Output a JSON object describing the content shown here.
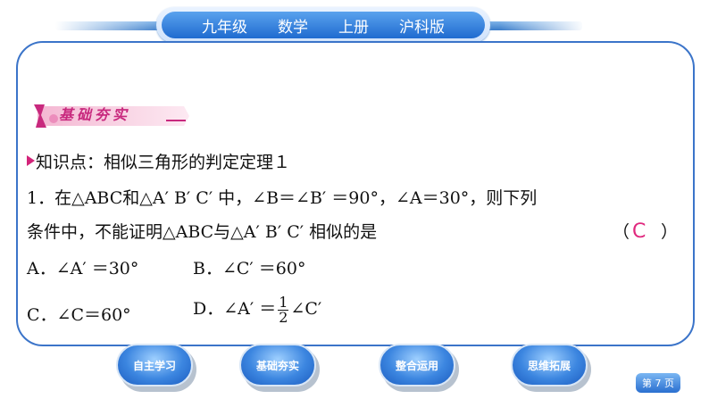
{
  "header": {
    "items": [
      "九年级",
      "数学",
      "上册",
      "沪科版"
    ]
  },
  "section": {
    "banner": "基础夯实"
  },
  "knowledge_point": "知识点：相似三角形的判定定理１",
  "question": {
    "line1": "1．在△ABC和△A′ B′ C′ 中，∠B＝∠B′ ＝90°，∠A＝30°，则下列",
    "line2": "条件中，不能证明△ABC与△A′ B′ C′ 相似的是",
    "paren_open": "（",
    "paren_close": "）",
    "answer": "C",
    "option_a": "A．∠A′ ＝30°",
    "option_b": "B．∠C′ ＝60°",
    "option_c": "C．∠C＝60°",
    "option_d_prefix": "D．∠A′ ＝",
    "option_d_num": "1",
    "option_d_den": "2",
    "option_d_suffix": "∠C′"
  },
  "nav": {
    "buttons": [
      "自主学习",
      "基础夯实",
      "整合运用",
      "思维拓展"
    ]
  },
  "page": {
    "label": "第 7 页"
  },
  "colors": {
    "accent_blue": "#3b74c9",
    "answer_pink": "#e0287e",
    "banner_pink": "#c8297e"
  }
}
